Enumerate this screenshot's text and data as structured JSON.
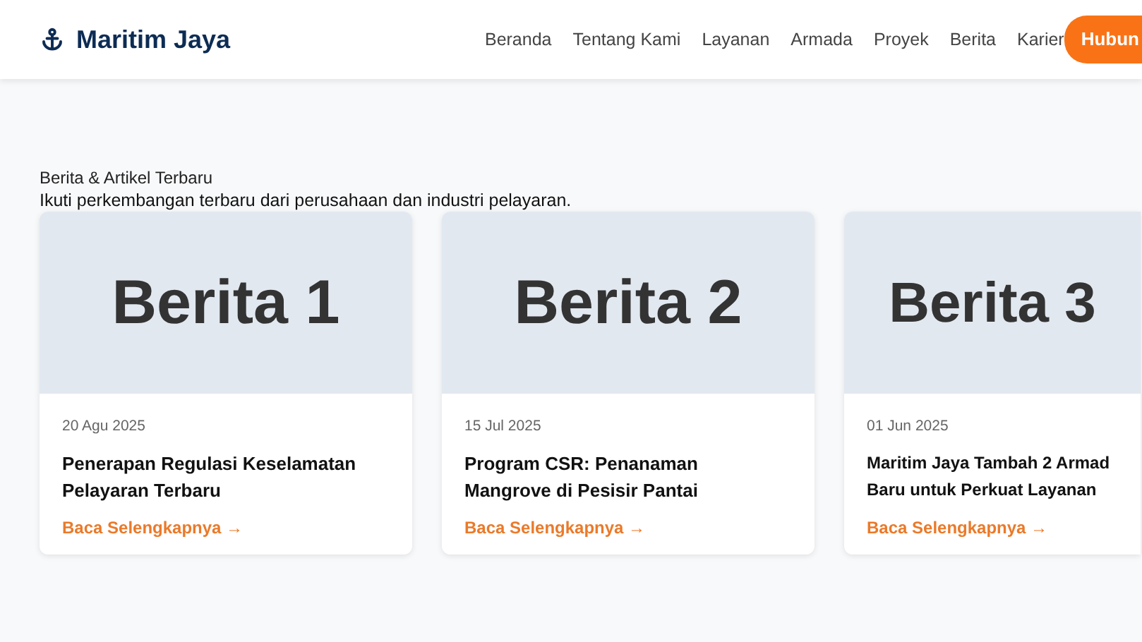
{
  "navbar": {
    "brand": "Maritim Jaya",
    "links": [
      "Beranda",
      "Tentang Kami",
      "Layanan",
      "Armada",
      "Proyek",
      "Berita",
      "Karier"
    ],
    "cta": "Hubun"
  },
  "section": {
    "title": "Berita & Artikel Terbaru",
    "subtitle": "Ikuti perkembangan terbaru dari perusahaan dan industri pelayaran."
  },
  "articles": [
    {
      "image_text": "Berita 1",
      "date": "20 Agu 2025",
      "title_lines": [
        "Penerapan Regulasi Keselamatan",
        "Pelayaran Terbaru"
      ],
      "link": "Baca Selengkapnya →"
    },
    {
      "image_text": "Berita 2",
      "date": "15 Jul 2025",
      "title_lines": [
        "Program CSR: Penanaman",
        "Mangrove di Pesisir Pantai"
      ],
      "link": "Baca Selengkapnya →"
    },
    {
      "image_text": "Berita 3",
      "date": "01 Jun 2025",
      "title_lines": [
        "Maritim Jaya Tambah 2 Armad",
        "Baru untuk Perkuat Layanan"
      ],
      "link": "Baca Selengkapnya →"
    }
  ]
}
